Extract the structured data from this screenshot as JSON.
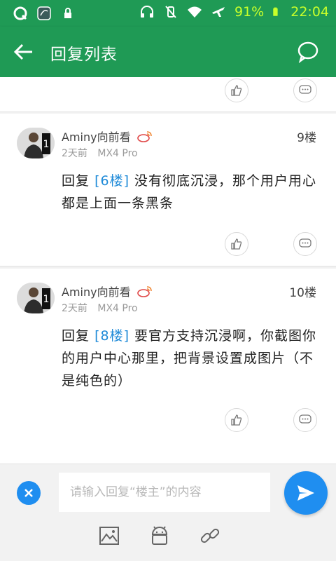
{
  "status_bar": {
    "battery_percent": "91%",
    "time": "22:04",
    "icons": [
      "q-app-icon",
      "notification-icon",
      "lock-icon",
      "headphones-icon",
      "mute-icon",
      "wifi-icon",
      "airplane-icon",
      "battery-icon"
    ]
  },
  "appbar": {
    "title": "回复列表"
  },
  "posts": [
    {
      "author": "Aminy向前看",
      "time": "2天前",
      "device": "MX4 Pro",
      "floor": "9楼",
      "reply_prefix": "回复",
      "reply_ref": "[6楼]",
      "reply_text": " 没有彻底沉浸，那个用户用心都是上面一条黑条"
    },
    {
      "author": "Aminy向前看",
      "time": "2天前",
      "device": "MX4 Pro",
      "floor": "10楼",
      "reply_prefix": "回复",
      "reply_ref": "[8楼]",
      "reply_text": " 要官方支持沉浸啊，你截图你的用户中心那里，把背景设置成图片（不是纯色的）"
    }
  ],
  "composer": {
    "placeholder": "请输入回复“楼主”的内容",
    "tools": [
      "image-icon",
      "android-icon",
      "link-icon"
    ]
  },
  "colors": {
    "primary_green": "#1f9a55",
    "accent_blue": "#1f8ef0",
    "link_blue": "#1e8ad8"
  }
}
